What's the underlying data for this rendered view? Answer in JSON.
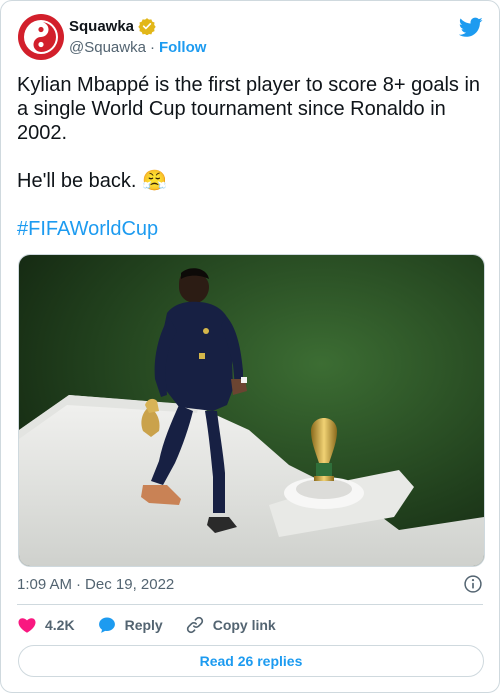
{
  "author": {
    "display_name": "Squawka",
    "handle": "@Squawka",
    "follow_label": "Follow",
    "verified": true
  },
  "tweet": {
    "line1": "Kylian Mbappé is the first player to score 8+ goals in a single World Cup tournament since Ronaldo in 2002.",
    "line2": "He'll be back.",
    "emoji": "😤",
    "hashtag": "#FIFAWorldCup"
  },
  "meta": {
    "time": "1:09 AM",
    "separator": "·",
    "date": "Dec 19, 2022"
  },
  "actions": {
    "likes": "4.2K",
    "reply_label": "Reply",
    "copy_label": "Copy link"
  },
  "read_replies_label": "Read 26 replies",
  "icons": {
    "avatar": "squawka-logo",
    "verified": "verified-badge-icon",
    "brand": "twitter-bird-icon",
    "info": "info-icon",
    "like": "heart-icon",
    "reply": "reply-bubble-icon",
    "copy": "link-icon"
  },
  "colors": {
    "accent": "#1d9bf0",
    "like": "#f91880",
    "squawka_red": "#d21f2b",
    "verified_gold": "#e2b719",
    "text_secondary": "#536471"
  }
}
